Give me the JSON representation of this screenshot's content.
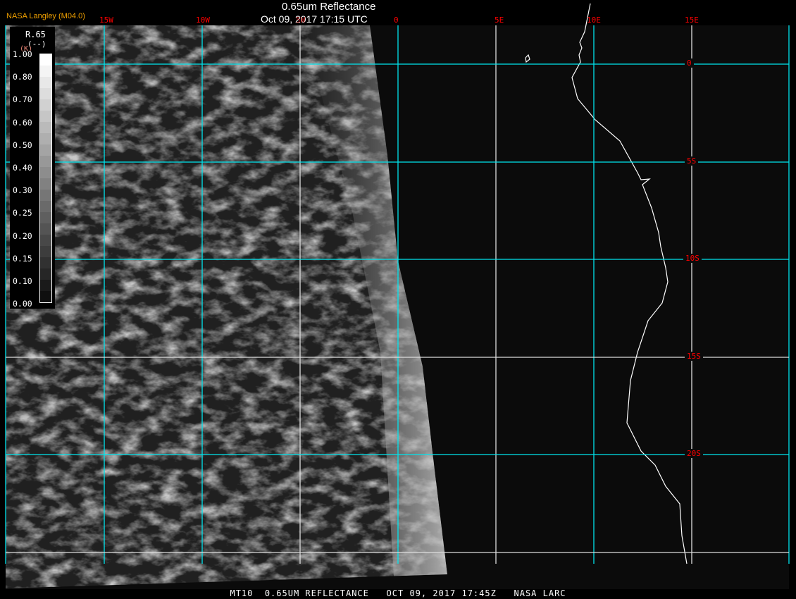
{
  "header": {
    "title": "0.65um Reflectance",
    "subtitle": "Oct 09, 2017 17:15 UTC",
    "credit": "NASA Langley (M04.0)"
  },
  "grid": {
    "lon_labels": [
      "15W",
      "10W",
      "5W",
      "0",
      "5E",
      "10E",
      "15E"
    ],
    "lat_labels": [
      "0",
      "5S",
      "10S",
      "15S",
      "20S"
    ]
  },
  "legend": {
    "variable": "R.65",
    "unit": "(--)",
    "unit_alt": "(K)",
    "labels": [
      "1.00",
      "0.80",
      "0.70",
      "0.60",
      "0.50",
      "0.40",
      "0.30",
      "0.25",
      "0.20",
      "0.15",
      "0.10",
      "0.00"
    ]
  },
  "footer": "MT10  0.65UM REFLECTANCE   OCT 09, 2017 17:45Z   NASA LARC",
  "colors": {
    "grid": "#00e5ee",
    "labels": "#ff0000",
    "credit": "#f0a000"
  }
}
